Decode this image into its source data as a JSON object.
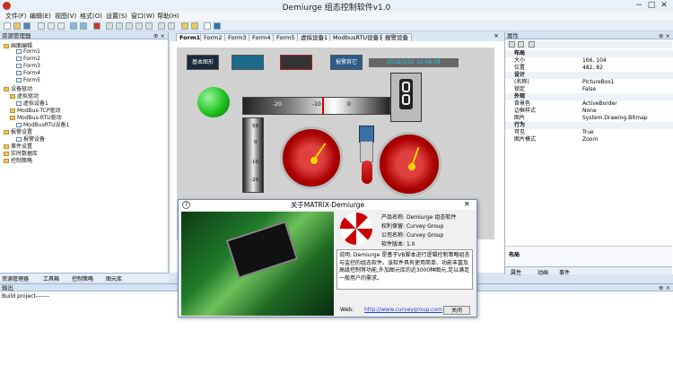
{
  "window": {
    "title": "Demiurge 组态控制软件v1.0",
    "min": "−",
    "max": "□",
    "close": "✕"
  },
  "menu": [
    "文件(F)",
    "编辑(E)",
    "视图(V)",
    "格式(O)",
    "设置(S)",
    "窗口(W)",
    "帮助(H)"
  ],
  "resource_panel": {
    "title": "资源管理器",
    "pin": "⊕ ×",
    "items": [
      {
        "label": "画面编辑",
        "level": 0,
        "icon": "folder-icon"
      },
      {
        "label": "Form1",
        "level": 2,
        "icon": "page-icon"
      },
      {
        "label": "Form2",
        "level": 2,
        "icon": "page-icon"
      },
      {
        "label": "Form3",
        "level": 2,
        "icon": "page-icon"
      },
      {
        "label": "Form4",
        "level": 2,
        "icon": "page-icon"
      },
      {
        "label": "Form5",
        "level": 2,
        "icon": "page-icon"
      },
      {
        "label": "设备驱动",
        "level": 0,
        "icon": "folder-icon"
      },
      {
        "label": "虚拟驱动",
        "level": 1,
        "icon": "folder-icon"
      },
      {
        "label": "虚拟设备1",
        "level": 2,
        "icon": "device-icon"
      },
      {
        "label": "ModBus-TCP驱动",
        "level": 1,
        "icon": "folder-icon"
      },
      {
        "label": "ModBus-RTU驱动",
        "level": 1,
        "icon": "folder-icon"
      },
      {
        "label": "ModBusRTU设备1",
        "level": 2,
        "icon": "device-icon"
      },
      {
        "label": "报警设置",
        "level": 0,
        "icon": "folder-icon"
      },
      {
        "label": "报警设备",
        "level": 2,
        "icon": "device-icon"
      },
      {
        "label": "事件设置",
        "level": 0,
        "icon": "folder-icon"
      },
      {
        "label": "实时数据库",
        "level": 0,
        "icon": "folder-icon"
      },
      {
        "label": "控制策略",
        "level": 0,
        "icon": "folder-icon"
      }
    ]
  },
  "bottom_tabs": [
    "资源管理器",
    "工具箱",
    "控制策略",
    "图元库"
  ],
  "doc_tabs": [
    "Form1",
    "Form2",
    "Form3",
    "Form4",
    "Form5",
    "虚拟设备1",
    "ModbusRTU设备1",
    "报警设备"
  ],
  "doc_tabs_close": "×",
  "canvas": {
    "btn1": "基本图形",
    "btn2": "",
    "btn3": "",
    "btn4": "报警其它",
    "datetime": "2016/3/31 10:08:08",
    "ruler_top": [
      "-20",
      "-10",
      "0"
    ],
    "ruler_side": [
      "50",
      "0",
      "-10",
      "-20"
    ]
  },
  "props_panel": {
    "title": "属性",
    "pin": "⊕ ×",
    "rows": [
      {
        "cat": true,
        "k": "布局",
        "v": ""
      },
      {
        "k": "大小",
        "v": "166, 104"
      },
      {
        "k": "位置",
        "v": "482, 82"
      },
      {
        "cat": true,
        "k": "设计",
        "v": ""
      },
      {
        "k": "(名称)",
        "v": "PictureBox1"
      },
      {
        "k": "锁定",
        "v": "False"
      },
      {
        "cat": true,
        "k": "外观",
        "v": ""
      },
      {
        "k": "背景色",
        "v": "ActiveBorder"
      },
      {
        "k": "边框样式",
        "v": "None"
      },
      {
        "k": "图片",
        "v": "System.Drawing.Bitmap"
      },
      {
        "cat": true,
        "k": "行为",
        "v": ""
      },
      {
        "k": "可见",
        "v": "True"
      },
      {
        "k": "图片模式",
        "v": "Zoom"
      }
    ],
    "desc_title": "布局",
    "tabs": [
      "属性",
      "动画",
      "事件"
    ]
  },
  "output": {
    "title": "输出",
    "pin": "⊕ ×",
    "text": "Build project-------"
  },
  "about": {
    "title": "关于MATRIX-Demiurge",
    "close": "✕",
    "product_label": "产品名称:",
    "product": "Demiurge 组态软件",
    "copyright_label": "权利保留:",
    "copyright": "Curvey Group",
    "company_label": "公司名称:",
    "company": "Curvey Group",
    "version_label": "软件版本:",
    "version": "1.0",
    "desc": "说明: Demiurge 是基于VB脚本进行逻辑控制策略组态与监控的组态软件。该软件具有使用简单、功能丰富及高级控制等功能,外加图元库的近3000种图元,足以满足一般用户的需求。",
    "web_label": "Web:",
    "web": "http://www.curveygroup.com",
    "ok": "关闭"
  },
  "colors": {
    "accent": "#3470b8",
    "gauge_red": "#b01212",
    "led_green": "#1fc21f"
  }
}
